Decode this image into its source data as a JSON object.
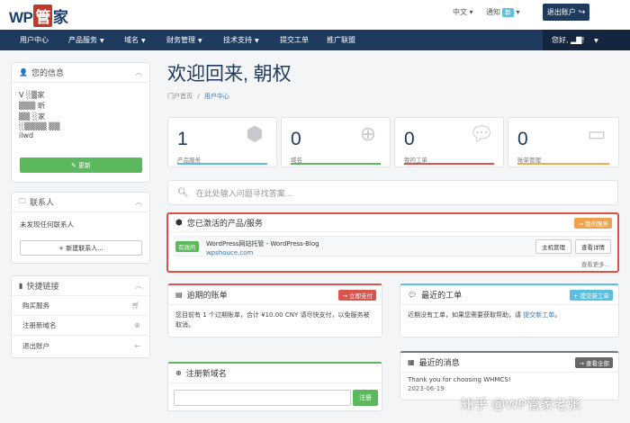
{
  "brand": {
    "logo_pre": "WP",
    "logo_box": "管",
    "logo_post": "家"
  },
  "topbar": {
    "language": "中文",
    "notifications_label": "通知",
    "notifications_badge": "新",
    "logout_label": "退出账户"
  },
  "nav": {
    "items": [
      {
        "label": "用户中心",
        "dropdown": false
      },
      {
        "label": "产品服务",
        "dropdown": true
      },
      {
        "label": "域名",
        "dropdown": true
      },
      {
        "label": "财务管理",
        "dropdown": true
      },
      {
        "label": "技术支持",
        "dropdown": true
      },
      {
        "label": "提交工单",
        "dropdown": false
      },
      {
        "label": "推广联盟",
        "dropdown": false
      }
    ],
    "user_greeting": "您好, ▂▇!"
  },
  "sidebar": {
    "info": {
      "title": "您的信息",
      "lines": [
        "V ░▒家",
        "▒▒▒ 昕",
        "▒▒ ░家",
        "░▒▒▒▒ ▒▒",
        "ilwd"
      ],
      "update_label": "✎ 更新"
    },
    "contacts": {
      "title": "联系人",
      "empty_text": "未发现任何联系人",
      "new_contact_label": "+ 新建联系人..."
    },
    "quick_links": {
      "title": "快捷链接",
      "items": [
        {
          "label": "购买服务",
          "icon": "cart-icon"
        },
        {
          "label": "注册新域名",
          "icon": "globe-icon"
        },
        {
          "label": "退出账户",
          "icon": "arrow-left-icon"
        }
      ]
    }
  },
  "main": {
    "welcome": "欢迎回来, 朝权",
    "breadcrumb": {
      "home": "门户首页",
      "sep": "/",
      "current": "用户中心"
    },
    "stats": [
      {
        "value": "1",
        "label": "产品服务",
        "icon": "cube-icon",
        "color": "#5bc0de"
      },
      {
        "value": "0",
        "label": "域名",
        "icon": "globe-icon",
        "color": "#5cb85c"
      },
      {
        "value": "0",
        "label": "我的工单",
        "icon": "chat-icon",
        "color": "#d9534f"
      },
      {
        "value": "0",
        "label": "账单管理",
        "icon": "credit-card-icon",
        "color": "#f0ad4e"
      }
    ],
    "search_placeholder": "在此处输入问题寻找答案...",
    "products": {
      "title": "您已激活的产品/服务",
      "my_services_label": "→ 我的服务",
      "item": {
        "status": "有效的",
        "name": "WordPress网站托管 - WordPress-Blog",
        "url": "wpshouce.com",
        "manage_label": "主机管理",
        "details_label": "查看详情"
      },
      "more_label": "查看更多..."
    },
    "overdue": {
      "title": "逾期的账单",
      "action": "→ 立即支付",
      "text": "您目前有 1 个过期账单，合计 ¥10.00 CNY 请尽快支付，以免服务被取消。"
    },
    "tickets": {
      "title": "最近的工单",
      "action": "+ 提交新工单",
      "text_pre": "近期没有工单，如果您需要获取帮助，请 ",
      "link": "提交新工单",
      "text_post": "。"
    },
    "register_domain": {
      "title": "注册新域名",
      "button": "注册"
    },
    "news": {
      "title": "最近的消息",
      "action": "→ 查看全部",
      "message": "Thank you for choosing WHMCS!",
      "date": "2023-06-19"
    }
  },
  "watermark": "知乎 @WP管家老张",
  "colors": {
    "navy": "#1f3a5f",
    "accent_orange": "#f0a24a",
    "danger": "#d9534f",
    "success": "#5cb85c",
    "info": "#5bc0de"
  }
}
